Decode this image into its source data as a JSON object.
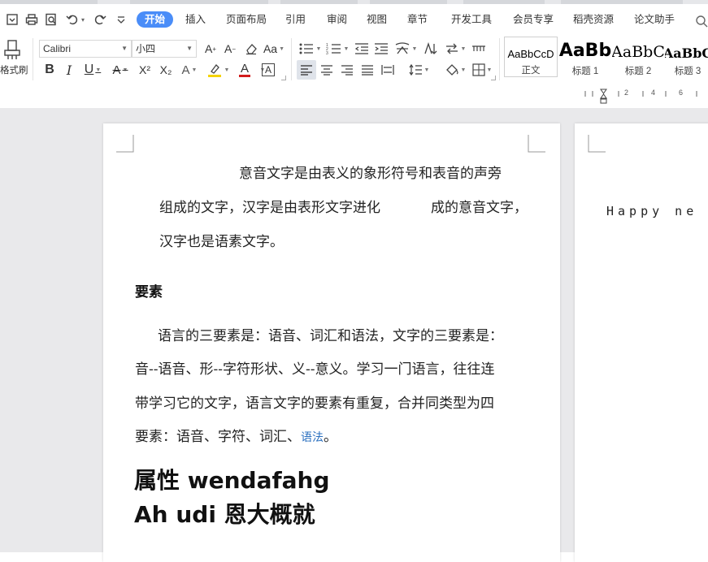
{
  "menu": {
    "tabs": [
      "开始",
      "插入",
      "页面布局",
      "引用",
      "审阅",
      "视图",
      "章节",
      "开发工具",
      "会员专享",
      "稻壳资源",
      "论文助手"
    ],
    "active_tab": "开始",
    "accent": "#4a8df8"
  },
  "quick_access": [
    "save-icon",
    "print-icon",
    "print-preview-icon",
    "undo-icon",
    "redo-icon",
    "customize-icon"
  ],
  "ribbon": {
    "format_painter_label": "格式刷",
    "font_name": "Calibri",
    "font_size": "小四",
    "styles": [
      {
        "sample": "AaBbCcD",
        "name": "正文"
      },
      {
        "sample": "AaBb",
        "name": "标题 1"
      },
      {
        "sample": "AaBbC",
        "name": "标题 2"
      },
      {
        "sample": "AaBbC",
        "name": "标题 3"
      }
    ],
    "buttons": {
      "bold": "B",
      "italic": "I",
      "underline": "U",
      "strike": "A",
      "superscript": "X²",
      "subscript": "X₂",
      "text_effect": "A",
      "font_color": "A",
      "char_border": "A",
      "grow": "A⁺",
      "shrink": "A⁻",
      "change_case": "Aa"
    },
    "highlight_color": "#f5d300",
    "font_color_bar": "#d21b1b"
  },
  "ruler": {
    "labels": [
      "2",
      "4",
      "6"
    ]
  },
  "document": {
    "page1": {
      "para1_line1": "意音文字是由表义的象形符号和表音的声旁",
      "para1_line2": "组成的文字，汉字是由表形文字进化",
      "para1_line2b": "成的意音文字，",
      "para1_line3": "汉字也是语素文字。",
      "heading": "要素",
      "para2_line1": "语言的三要素是：语音、词汇和语法，文字的三要素是：",
      "para2_line2": "音--语音、形--字符形状、义--意义。学习一门语言，往往连",
      "para2_line3": "带学习它的文字，语言文字的要素有重复，合并同类型为四",
      "para2_line4a": "要素：语音、字符、词汇、",
      "para2_line4_link": "语法",
      "para2_line4b": "。",
      "big1": "属性 wendafahg",
      "big2": "Ah udi 恩大概就"
    },
    "page2": {
      "text": "Happy ne"
    }
  }
}
